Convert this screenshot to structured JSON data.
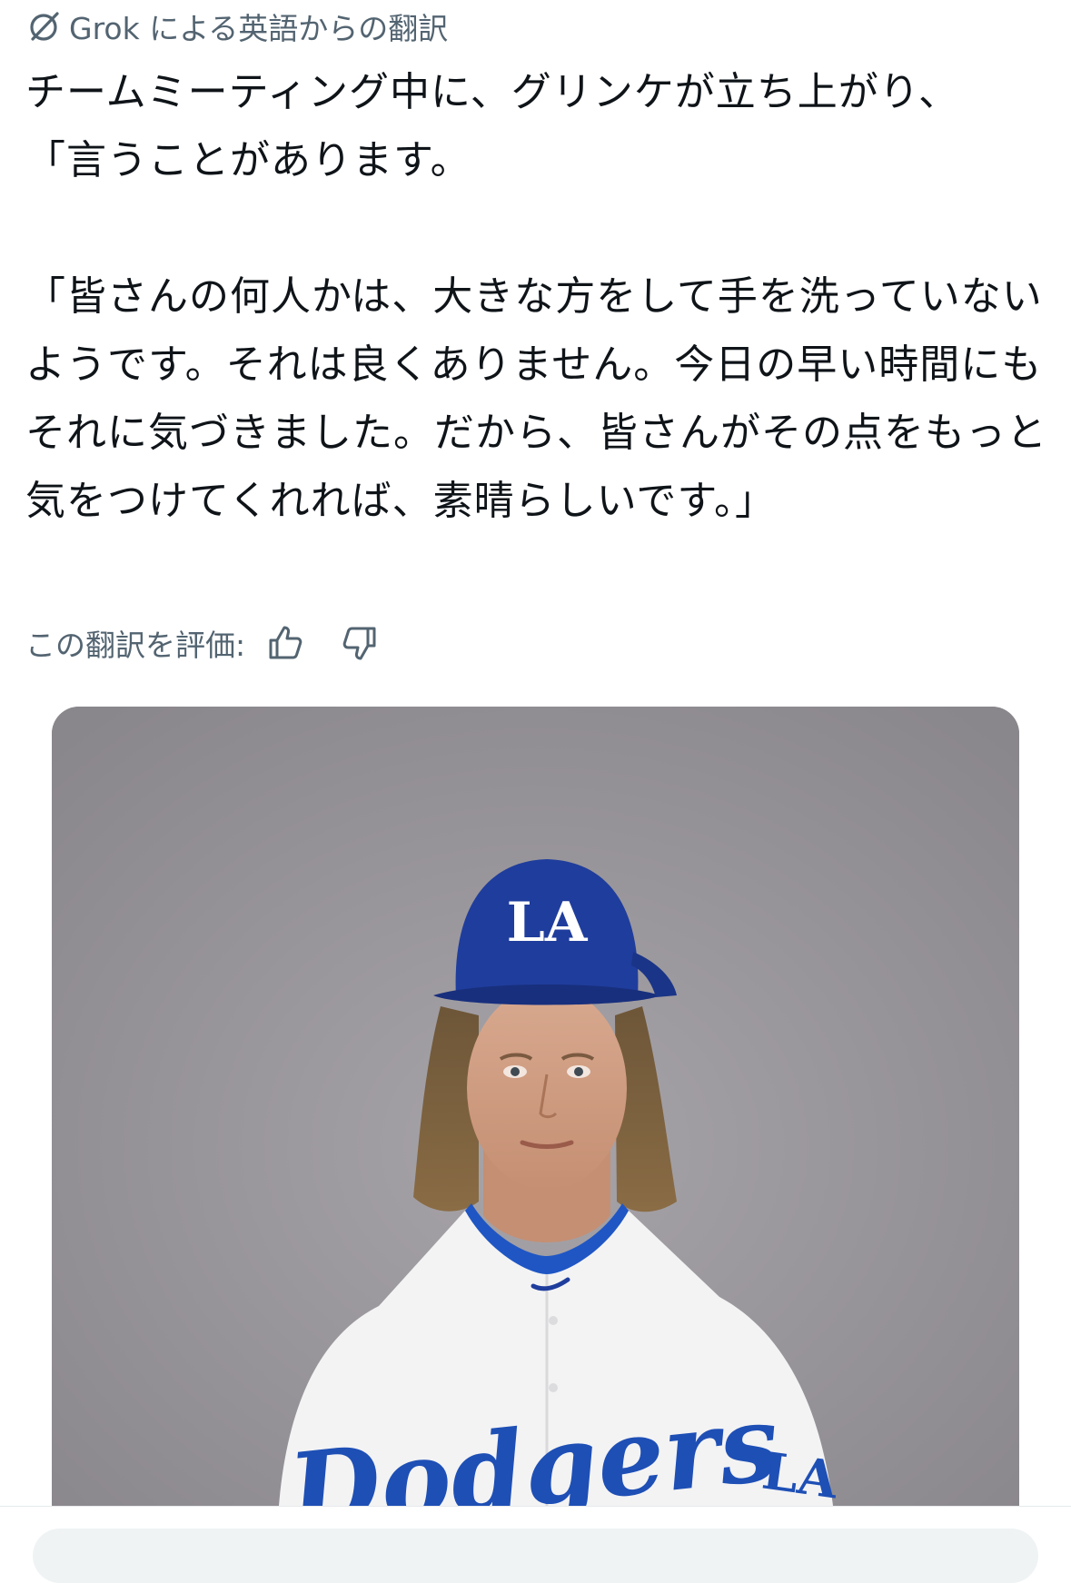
{
  "header": {
    "label": "Grok による英語からの翻訳",
    "icon": "grok-icon"
  },
  "translation": {
    "text": "チームミーティング中に、グリンケが立ち上がり、\n「言うことがあります。\n\n「皆さんの何人かは、大きな方をして手を洗っていないようです。それは良くありません。今日の早い時間にもそれに気づきました。だから、皆さんがその点をもっと気をつけてくれれば、素晴らしいです。」"
  },
  "rating": {
    "label": "この翻訳を評価:",
    "like_icon": "thumbs-up-icon",
    "dislike_icon": "thumbs-down-icon"
  },
  "media": {
    "cap_logo": "LA",
    "jersey_text": "Dodgers",
    "sleeve_logo": "LA",
    "colors": {
      "cap": "#1f3d9c",
      "script": "#1e4fb5",
      "background": "#9a979c"
    }
  }
}
